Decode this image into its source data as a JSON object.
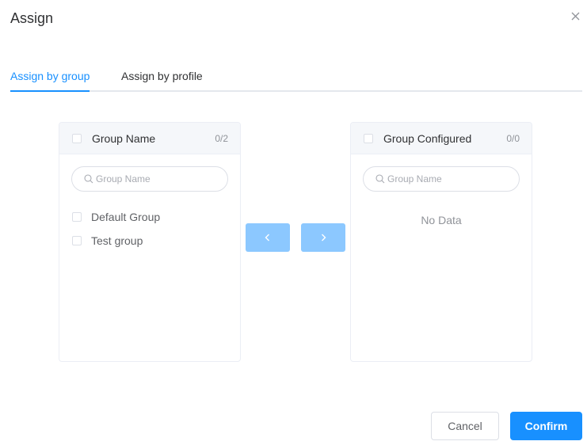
{
  "dialog": {
    "title": "Assign",
    "close_icon": "close-icon"
  },
  "tabs": [
    {
      "label": "Assign by group",
      "active": true
    },
    {
      "label": "Assign by profile",
      "active": false
    }
  ],
  "left_panel": {
    "title": "Group Name",
    "count": "0/2",
    "search_placeholder": "Group Name",
    "items": [
      {
        "label": "Default Group",
        "checked": false
      },
      {
        "label": "Test group",
        "checked": false
      }
    ]
  },
  "right_panel": {
    "title": "Group Configured",
    "count": "0/0",
    "search_placeholder": "Group Name",
    "empty_text": "No Data"
  },
  "transfer_buttons": {
    "to_left_icon": "chevron-left-icon",
    "to_right_icon": "chevron-right-icon"
  },
  "footer": {
    "cancel_label": "Cancel",
    "confirm_label": "Confirm"
  },
  "colors": {
    "primary": "#1890ff",
    "primary_disabled": "#8cc8ff",
    "border": "#dcdfe6",
    "header_bg": "#f5f7fa"
  }
}
